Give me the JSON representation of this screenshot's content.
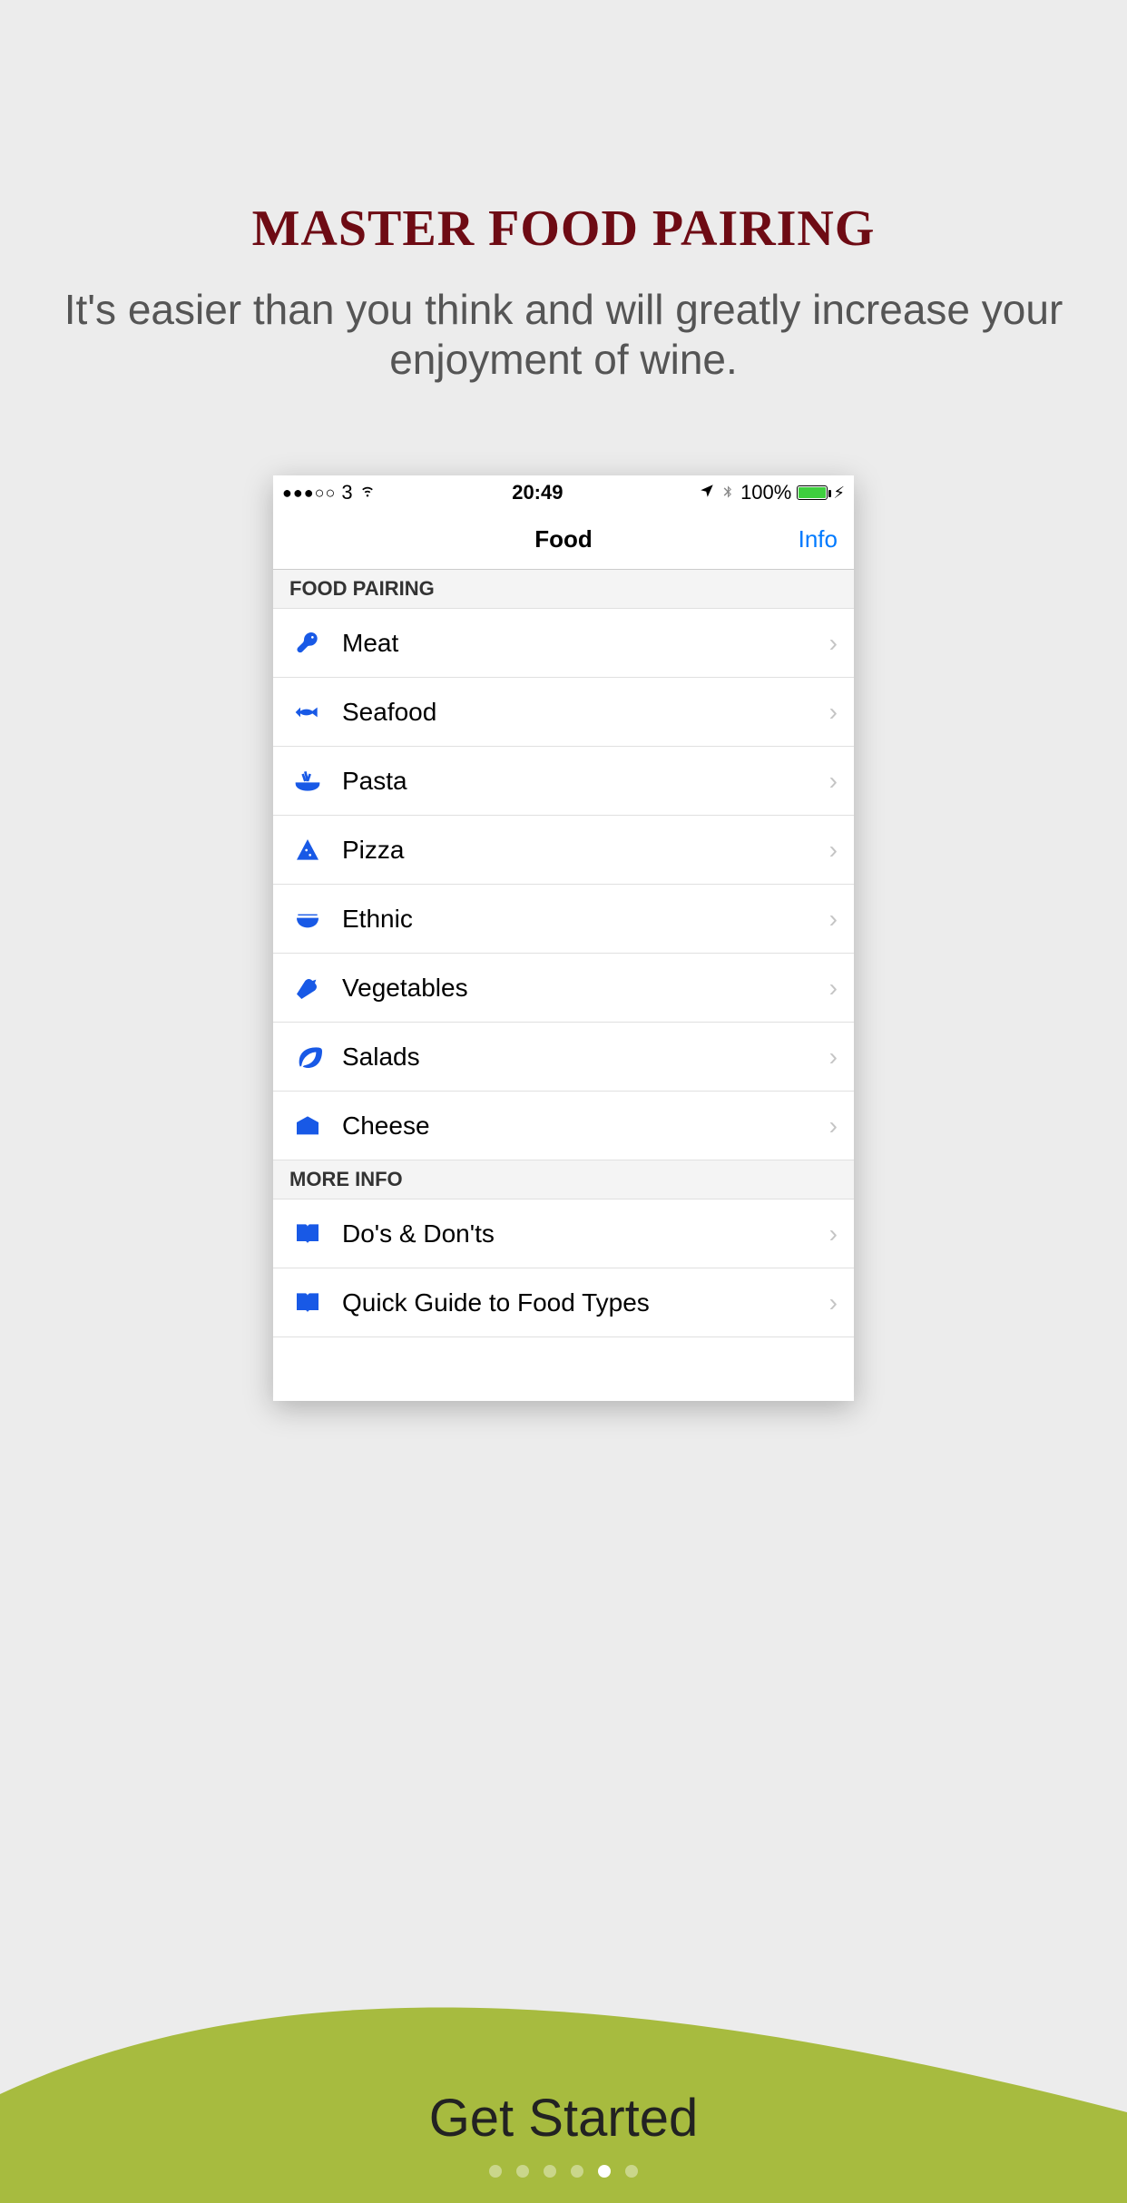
{
  "promo": {
    "title": "MASTER FOOD PAIRING",
    "subtitle": "It's easier than you think and will greatly increase your enjoyment of wine."
  },
  "status": {
    "carrier": "3",
    "time": "20:49",
    "battery_text": "100%"
  },
  "nav": {
    "title": "Food",
    "info_label": "Info"
  },
  "section1": {
    "header": "FOOD PAIRING",
    "items": [
      {
        "label": "Meat",
        "icon": "meat-icon"
      },
      {
        "label": "Seafood",
        "icon": "fish-icon"
      },
      {
        "label": "Pasta",
        "icon": "pasta-icon"
      },
      {
        "label": "Pizza",
        "icon": "pizza-icon"
      },
      {
        "label": "Ethnic",
        "icon": "bowl-icon"
      },
      {
        "label": "Vegetables",
        "icon": "carrot-icon"
      },
      {
        "label": "Salads",
        "icon": "leaf-icon"
      },
      {
        "label": "Cheese",
        "icon": "cheese-icon"
      }
    ]
  },
  "section2": {
    "header": "MORE INFO",
    "items": [
      {
        "label": "Do's & Don'ts",
        "icon": "book-icon"
      },
      {
        "label": "Quick Guide to Food Types",
        "icon": "book-icon"
      }
    ]
  },
  "cta": {
    "label": "Get Started"
  },
  "pager": {
    "count": 6,
    "active": 4
  }
}
